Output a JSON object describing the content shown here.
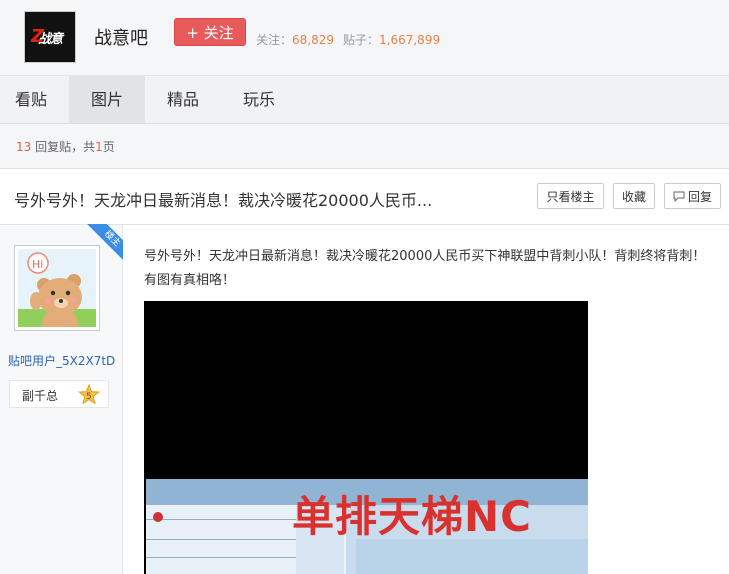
{
  "forum": {
    "name": "战意吧",
    "logo_text": "战意",
    "follow_label": "+ 关注",
    "follow_stat_label": "关注：",
    "follow_count": "68,829",
    "posts_stat_label": "贴子：",
    "posts_count": "1,667,899"
  },
  "nav": {
    "tabs": [
      {
        "label": "看贴",
        "active": false
      },
      {
        "label": "图片",
        "active": true
      },
      {
        "label": "精品",
        "active": false
      },
      {
        "label": "玩乐",
        "active": false
      }
    ]
  },
  "pager": {
    "reply_count": "13",
    "reply_suffix": "回复贴，共",
    "page_count": "1",
    "page_suffix": "页"
  },
  "thread": {
    "title": "号外号外！天龙冲日最新消息！裁决冷暖花20000人民币...",
    "only_op_label": "只看楼主",
    "favorite_label": "收藏",
    "reply_label": "回复"
  },
  "post": {
    "ribbon_label": "楼主",
    "author": "贴吧用户_5X2X7tD",
    "level_name": "副千总",
    "level_number": "5",
    "text": "号外号外！天龙冲日最新消息！裁决冷暖花20000人民币买下神联盟中背刺小队！背刺终将背刺！有图有真相咯！",
    "image_banner_text": "单排天梯NC"
  },
  "colors": {
    "accent_red": "#e85b5b",
    "link_blue": "#2d64b3",
    "stat_orange": "#e8804a"
  }
}
